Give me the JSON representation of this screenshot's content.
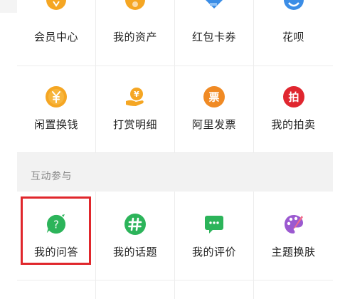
{
  "services_grid": {
    "row1": [
      {
        "label": "会员中心",
        "icon": "member-center-icon",
        "color": "#f5a623"
      },
      {
        "label": "我的资产",
        "icon": "my-assets-icon",
        "color": "#f5a623"
      },
      {
        "label": "红包卡券",
        "icon": "coupons-icon",
        "color": "#3b8de6"
      },
      {
        "label": "花呗",
        "icon": "huabei-icon",
        "color": "#3b8de6"
      }
    ],
    "row2": [
      {
        "label": "闲置换钱",
        "icon": "yen-coin-icon",
        "color": "#f5a623"
      },
      {
        "label": "打赏明细",
        "icon": "tip-hand-icon",
        "color": "#f5a623"
      },
      {
        "label": "阿里发票",
        "icon": "invoice-icon",
        "color": "#f08a24",
        "glyph": "票"
      },
      {
        "label": "我的拍卖",
        "icon": "auction-icon",
        "color": "#e0262f",
        "glyph": "拍"
      }
    ]
  },
  "interaction_section": {
    "title": "互动参与",
    "items": [
      {
        "label": "我的问答",
        "icon": "qa-bubble-icon",
        "color": "#2cb45a",
        "glyph": "?"
      },
      {
        "label": "我的话题",
        "icon": "topic-hash-icon",
        "color": "#2cb45a",
        "glyph": "#"
      },
      {
        "label": "我的评价",
        "icon": "review-chat-icon",
        "color": "#2cb45a",
        "glyph": "···"
      },
      {
        "label": "主题换肤",
        "icon": "theme-palette-icon",
        "color": "#9b59d0"
      }
    ]
  },
  "highlight_color": "#e0272c"
}
